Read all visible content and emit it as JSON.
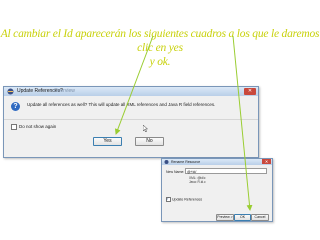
{
  "heading": {
    "line1": "Al cambiar el Id aparecerán los siguientes cuadros a los que le daremos clic en yes",
    "line2": "y ok."
  },
  "dialog_update": {
    "title": "Update References?",
    "faded_title": "Overview",
    "message": "Update all references as well? This will update all XML references and Java R field references.",
    "checkbox_label": "Do not show again",
    "yes_label": "Yes",
    "no_label": "No"
  },
  "dialog_rename": {
    "title": "Rename Resource",
    "new_name_label": "New Name:",
    "new_name_value": "@+id/",
    "line_a": "XML: @id/c",
    "line_b": "Java: R.id.c",
    "update_label": "Update References",
    "preview_label": "Preview >",
    "ok_label": "OK",
    "cancel_label": "Cancel"
  },
  "colors": {
    "heading": "#c8d10a",
    "arrow": "#9acd32"
  }
}
